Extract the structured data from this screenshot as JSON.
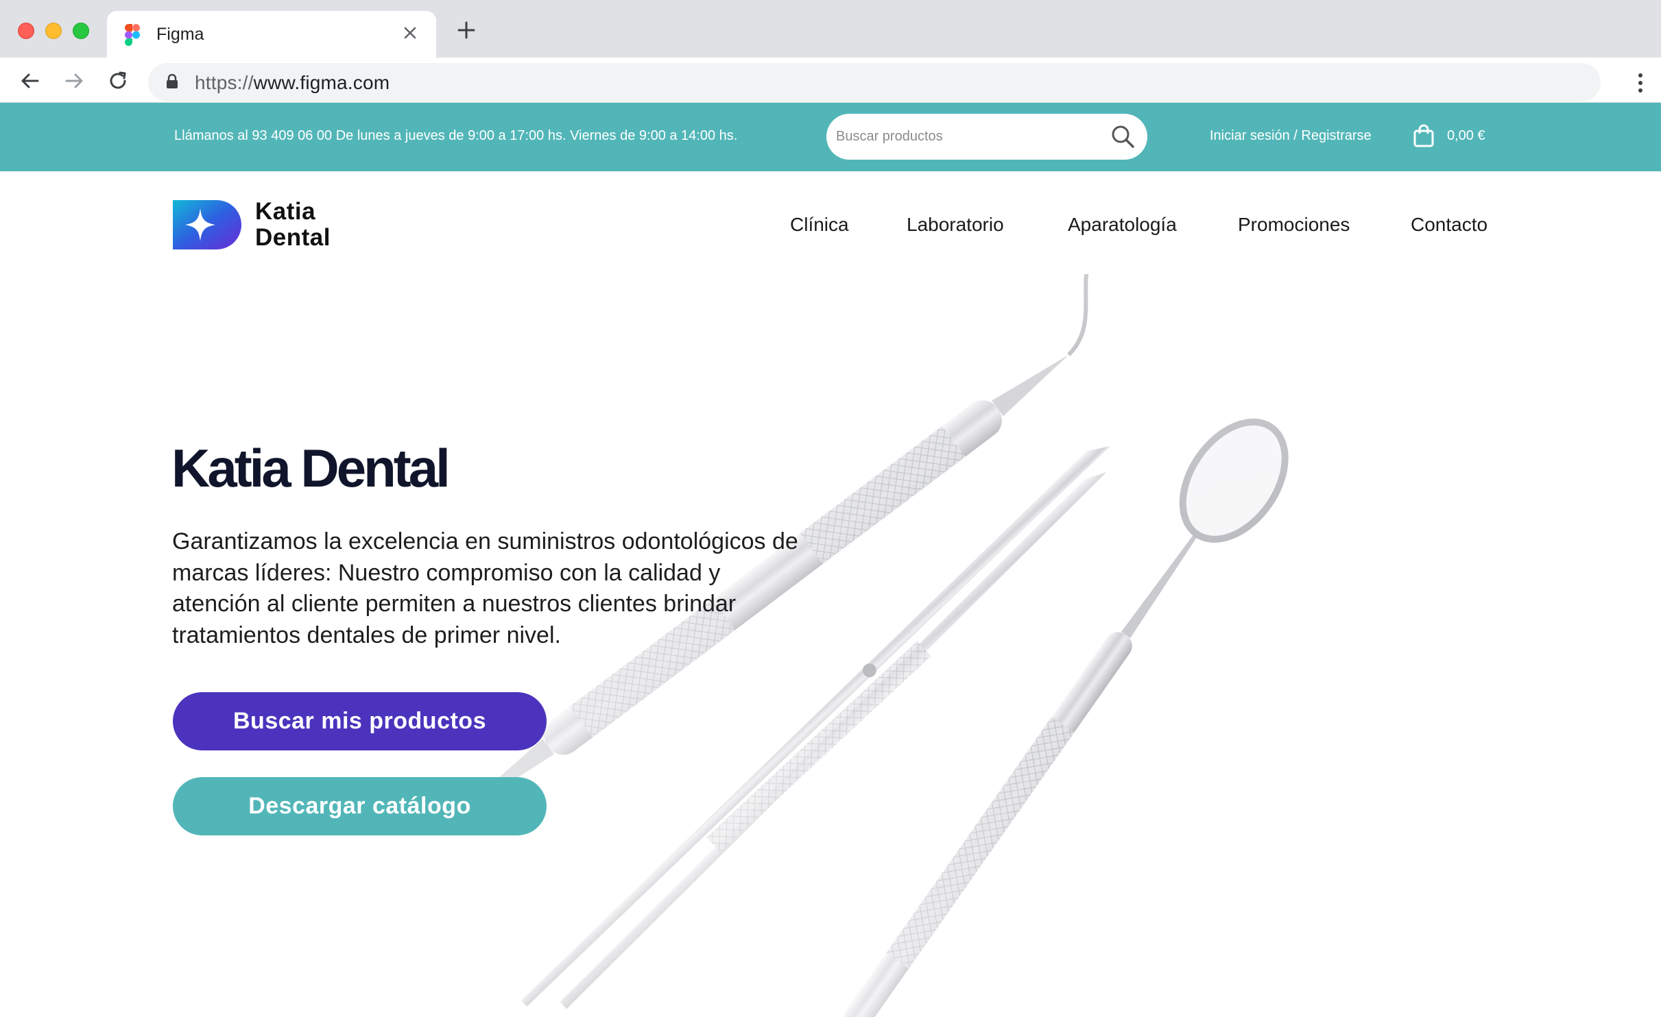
{
  "browser": {
    "tab_title": "Figma",
    "tab_close": "×",
    "url_protocol": "https://",
    "url_host": "www.figma.com"
  },
  "topbar": {
    "info": "Llámanos al 93 409 06 00 De lunes a jueves de 9:00 a 17:00 hs. Viernes de 9:00 a 14:00 hs.",
    "search_placeholder": "Buscar productos",
    "login": "Iniciar sesión / Registrarse",
    "cart_total": "0,00 €",
    "color": "#52b6b8"
  },
  "header": {
    "logo_line1": "Katia",
    "logo_line2": "Dental",
    "nav": [
      "Clínica",
      "Laboratorio",
      "Aparatología",
      "Promociones",
      "Contacto"
    ]
  },
  "hero": {
    "title": "Katia Dental",
    "description": "Garantizamos la excelencia en suministros odontológicos de marcas líderes: Nuestro compromiso con la calidad y atención al cliente permiten a nuestros clientes brindar tratamientos dentales de primer nivel.",
    "primary_button": "Buscar mis productos",
    "secondary_button": "Descargar catálogo",
    "primary_color": "#4b33bd",
    "secondary_color": "#52b6b8"
  },
  "icons": [
    "figma-icon",
    "close-icon",
    "plus-icon",
    "back-arrow-icon",
    "forward-arrow-icon",
    "reload-icon",
    "lock-icon",
    "kebab-menu-icon",
    "search-icon",
    "shopping-bag-icon",
    "logo-star-icon"
  ]
}
